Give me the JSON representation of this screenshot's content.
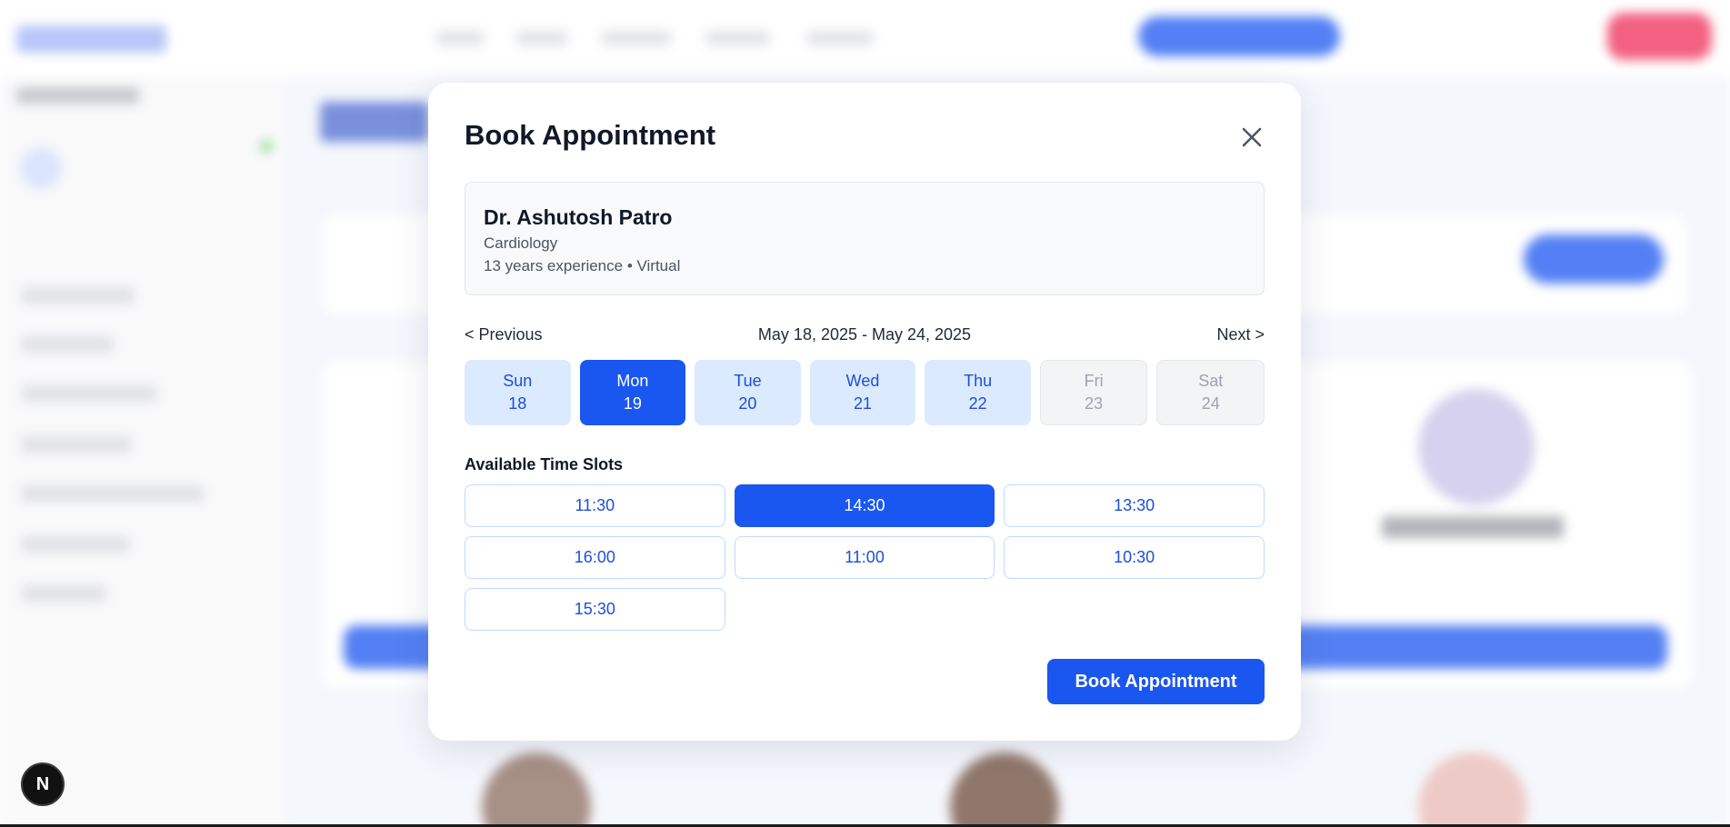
{
  "modal": {
    "title": "Book Appointment",
    "doctor": {
      "name": "Dr. Ashutosh Patro",
      "specialty": "Cardiology",
      "details": "13 years experience • Virtual"
    },
    "week_nav": {
      "previous_label": "< Previous",
      "range": "May 18, 2025 - May 24, 2025",
      "next_label": "Next >"
    },
    "days": [
      {
        "name": "Sun",
        "date": "18",
        "state": "available"
      },
      {
        "name": "Mon",
        "date": "19",
        "state": "selected"
      },
      {
        "name": "Tue",
        "date": "20",
        "state": "available"
      },
      {
        "name": "Wed",
        "date": "21",
        "state": "available"
      },
      {
        "name": "Thu",
        "date": "22",
        "state": "available"
      },
      {
        "name": "Fri",
        "date": "23",
        "state": "disabled"
      },
      {
        "name": "Sat",
        "date": "24",
        "state": "disabled"
      }
    ],
    "slots_label": "Available Time Slots",
    "slots": [
      {
        "time": "11:30",
        "selected": false
      },
      {
        "time": "14:30",
        "selected": true
      },
      {
        "time": "13:30",
        "selected": false
      },
      {
        "time": "16:00",
        "selected": false
      },
      {
        "time": "11:00",
        "selected": false
      },
      {
        "time": "10:30",
        "selected": false
      },
      {
        "time": "15:30",
        "selected": false
      }
    ],
    "book_button_label": "Book Appointment"
  },
  "dev_badge": {
    "label": "N"
  },
  "colors": {
    "primary": "#1a56f0",
    "selected_text": "#ffffff",
    "available_bg": "#dbeafe",
    "available_text": "#1d4ed8",
    "disabled_bg": "#f3f4f6",
    "disabled_text": "#9ca3af",
    "secondary_cta": "#ef2b57"
  }
}
